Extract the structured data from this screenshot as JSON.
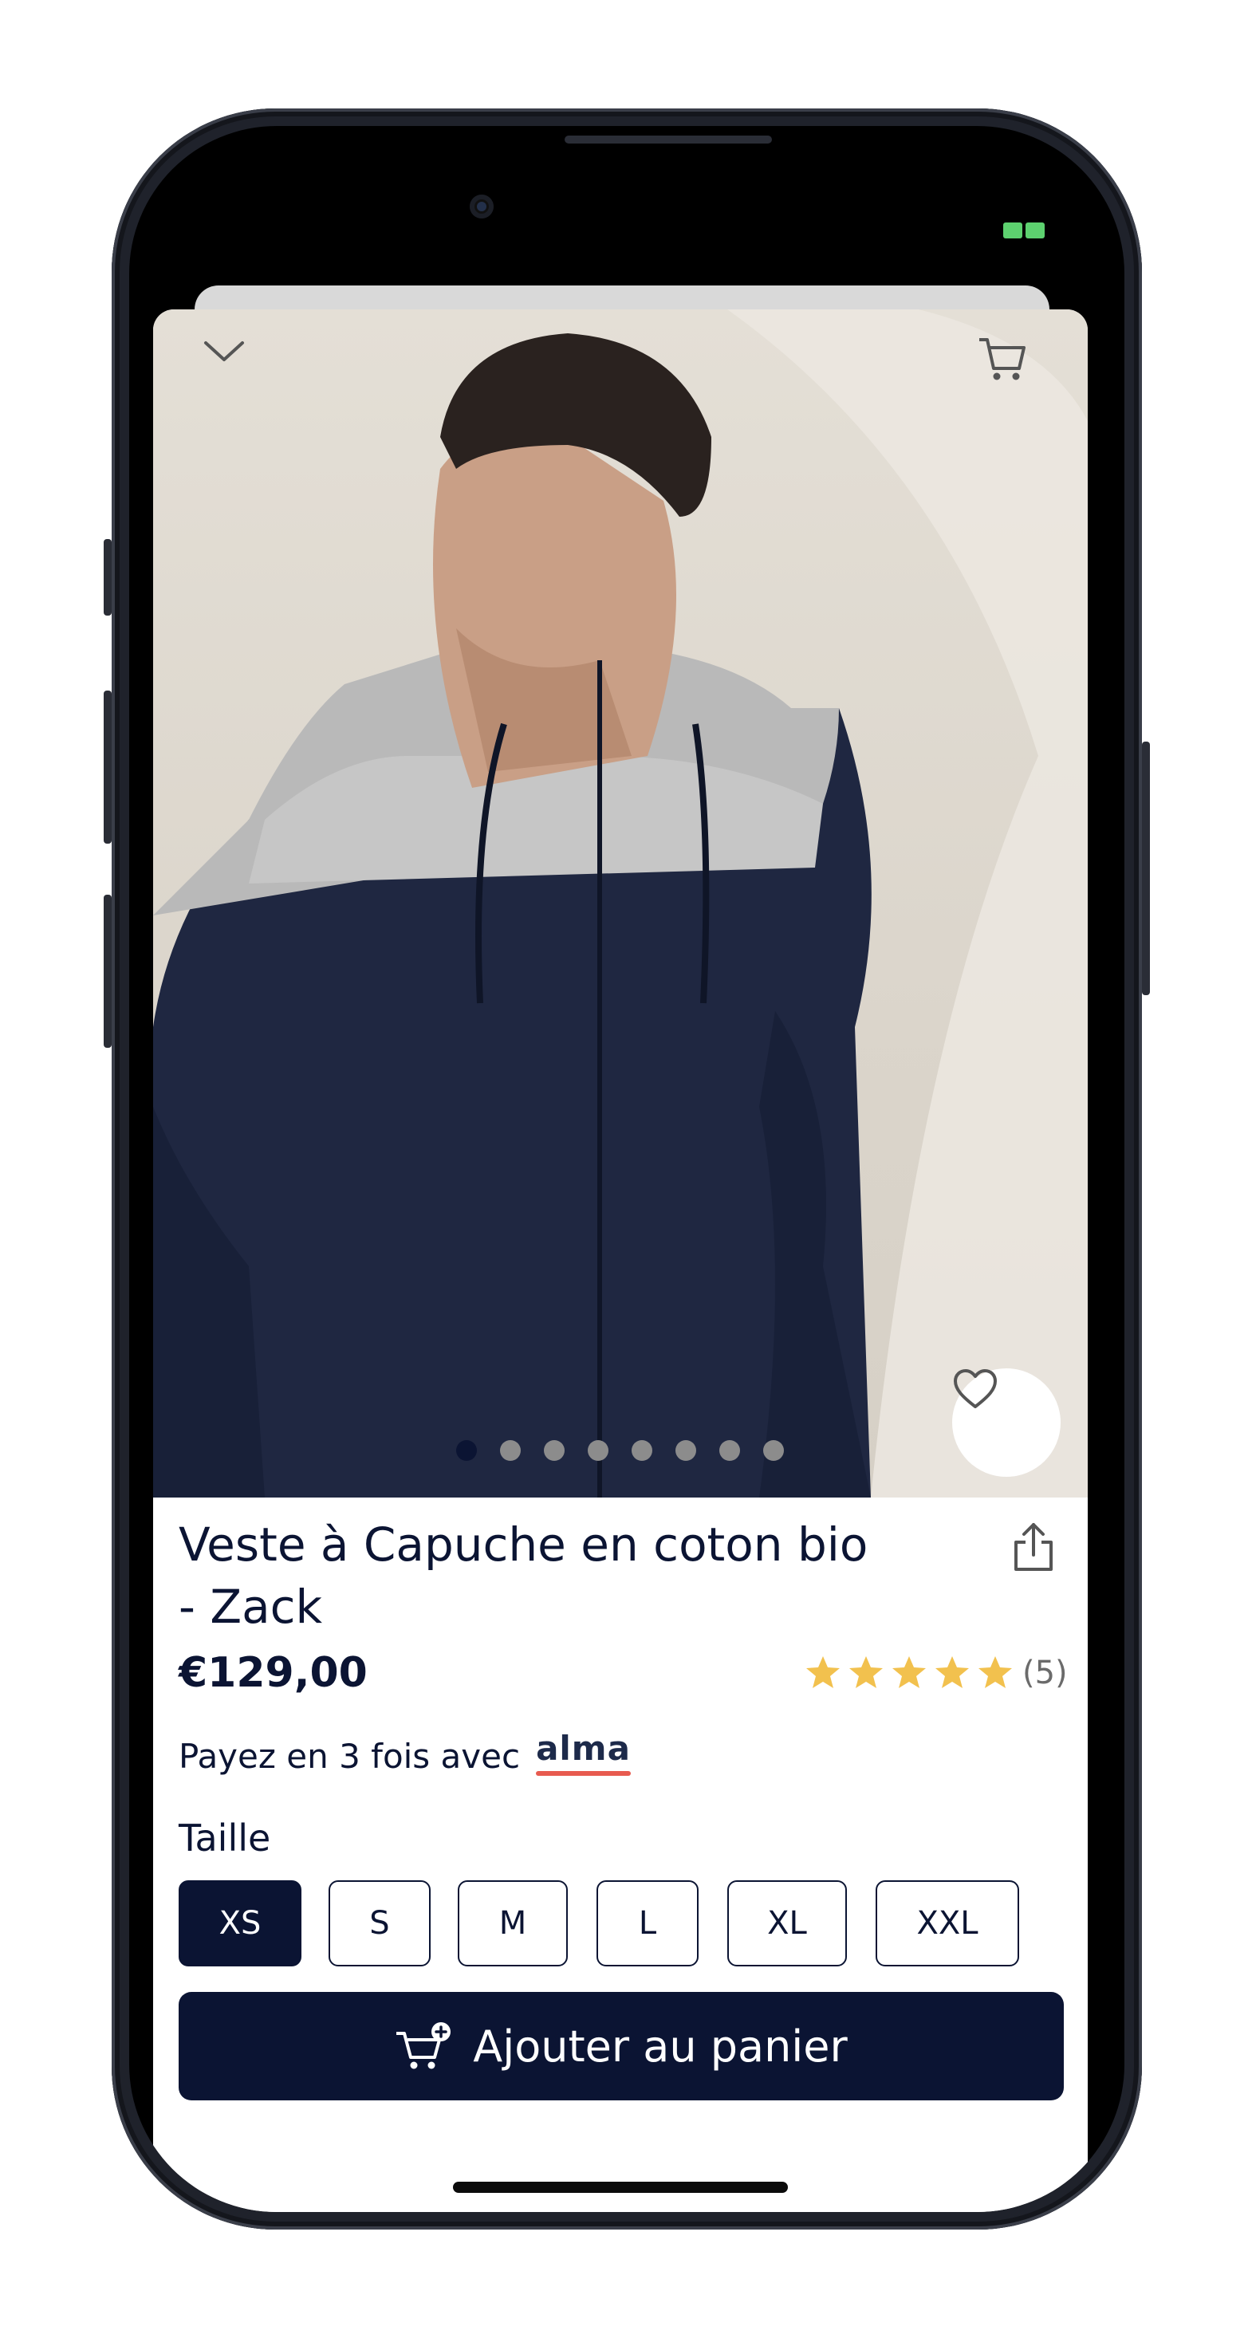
{
  "product": {
    "title_line1": "Veste à Capuche en coton bio",
    "title_line2": "- Zack",
    "price": "€129,00",
    "rating_count": "(5)",
    "rating_value": 5,
    "installments_text": "Payez en 3 fois avec",
    "installments_brand": "alma"
  },
  "gallery": {
    "image_count": 8,
    "active_index": 0
  },
  "size_selector": {
    "label": "Taille",
    "options": [
      "XS",
      "S",
      "M",
      "L",
      "XL",
      "XXL"
    ],
    "selected": "XS"
  },
  "actions": {
    "add_to_cart_label": "Ajouter au panier"
  },
  "colors": {
    "primary": "#0b1433",
    "star": "#f2c14e",
    "alma_accent": "#e85b4f",
    "status_green": "#5dd16f"
  },
  "icons": [
    "chevron-down-icon",
    "cart-icon",
    "heart-icon",
    "share-icon",
    "star-icon",
    "cart-plus-icon"
  ]
}
